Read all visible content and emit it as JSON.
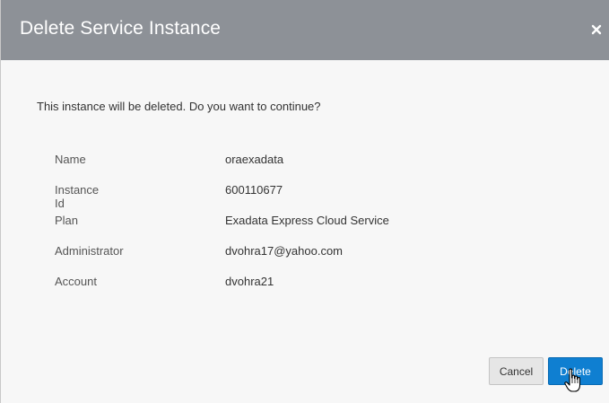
{
  "dialog": {
    "title": "Delete Service Instance",
    "close_icon": "close-icon",
    "message": "This instance will be deleted. Do you want to continue?"
  },
  "details": [
    {
      "label": "Name",
      "value": "oraexadata"
    },
    {
      "label": "Instance Id",
      "value": "600110677"
    },
    {
      "label": "Plan",
      "value": "Exadata Express Cloud Service"
    },
    {
      "label": "Administrator",
      "value": "dvohra17@yahoo.com"
    },
    {
      "label": "Account",
      "value": "dvohra21"
    }
  ],
  "buttons": {
    "cancel_label": "Cancel",
    "delete_label": "Delete"
  },
  "colors": {
    "header_bg": "#8d9197",
    "primary": "#0f7fd1",
    "body_bg": "#f7f7f7"
  }
}
